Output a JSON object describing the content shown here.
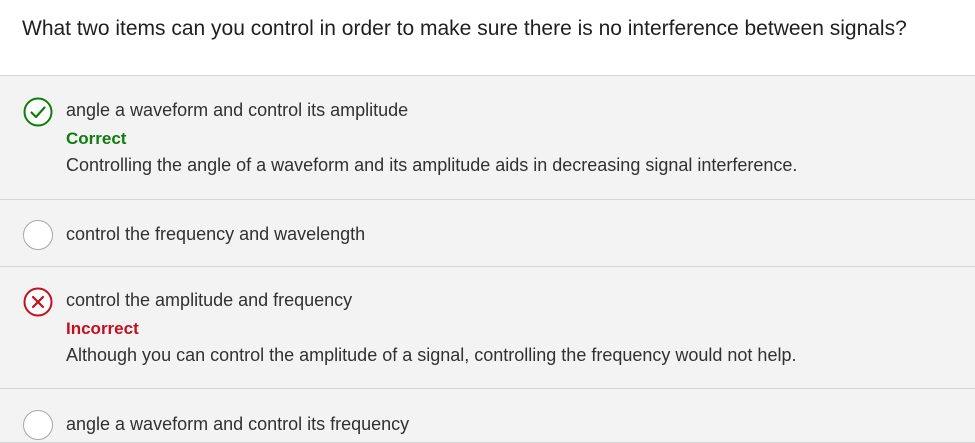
{
  "question": {
    "text": "What two items can you control in order to make sure there is no interference between signals?"
  },
  "options": [
    {
      "text": "angle a waveform and control its amplitude",
      "state": "correct",
      "status": "Correct",
      "explanation": "Controlling the angle of a waveform and its amplitude aids in decreasing signal interference.",
      "icon": "check-circle-icon"
    },
    {
      "text": "control the frequency and wavelength",
      "state": "unselected",
      "icon": "radio-empty-icon"
    },
    {
      "text": "control the amplitude and frequency",
      "state": "incorrect",
      "status": "Incorrect",
      "explanation": "Although you can control the amplitude of a signal, controlling the frequency would not help.",
      "icon": "x-circle-icon"
    },
    {
      "text": "angle a waveform and control its frequency",
      "state": "unselected",
      "icon": "radio-empty-icon"
    }
  ],
  "colors": {
    "correct": "#107c10",
    "incorrect": "#c50f1f",
    "option_background": "#f3f3f3",
    "divider": "#d6d6d6"
  }
}
